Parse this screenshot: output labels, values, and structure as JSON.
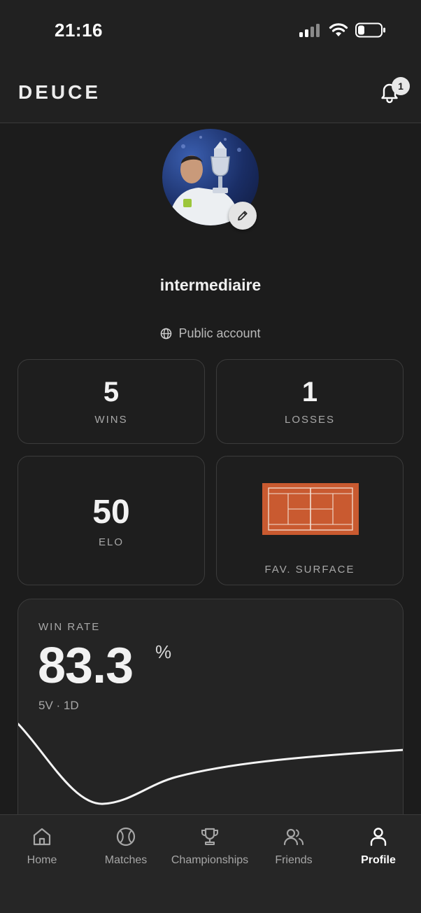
{
  "status_bar": {
    "time": "21:16"
  },
  "header": {
    "brand": "DEUCE",
    "notification_count": "1"
  },
  "profile": {
    "username": "intermediaire",
    "account_type": "Public account"
  },
  "stats": {
    "wins": {
      "value": "5",
      "label": "WINS"
    },
    "losses": {
      "value": "1",
      "label": "LOSSES"
    },
    "elo": {
      "value": "50",
      "label": "ELO"
    },
    "surface": {
      "label": "FAV. SURFACE",
      "color": "#c95a30"
    }
  },
  "win_rate": {
    "label": "WIN RATE",
    "value": "83.3",
    "unit": "%",
    "record": "5V · 1D"
  },
  "nav": [
    {
      "label": "Home",
      "icon": "home-icon"
    },
    {
      "label": "Matches",
      "icon": "tennis-ball-icon"
    },
    {
      "label": "Championships",
      "icon": "trophy-icon"
    },
    {
      "label": "Friends",
      "icon": "friends-icon"
    },
    {
      "label": "Profile",
      "icon": "profile-icon",
      "active": true
    }
  ],
  "colors": {
    "background": "#1c1c1c",
    "card": "#242424",
    "clay": "#c95a30"
  }
}
